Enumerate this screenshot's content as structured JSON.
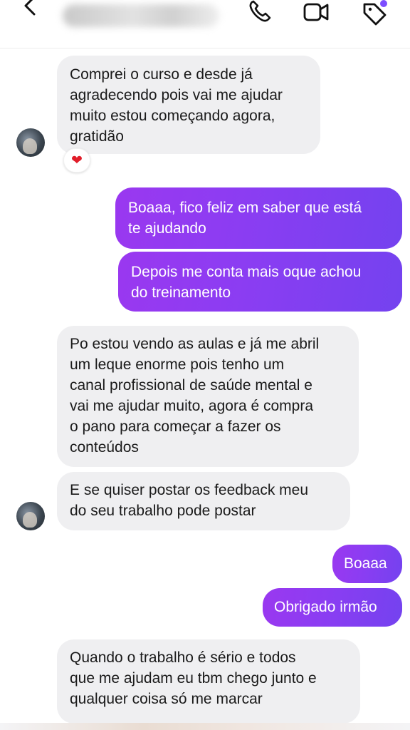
{
  "header": {
    "contact_name": "",
    "back_icon": "chevron-left-icon",
    "call_icon": "phone-icon",
    "video_icon": "video-camera-icon",
    "tag_icon": "tag-icon"
  },
  "colors": {
    "outgoing_bubble_start": "#9a38f0",
    "outgoing_bubble_end": "#7442ef",
    "incoming_bubble": "#efeff1",
    "notification_dot": "#7c4dff"
  },
  "messages": [
    {
      "direction": "in",
      "text": "Comprei o curso e desde já\nagradecendo pois vai me ajudar\nmuito estou começando agora,\ngratidão",
      "reaction": "❤"
    },
    {
      "direction": "out",
      "text": "Boaaa, fico feliz em saber que está\nte ajudando"
    },
    {
      "direction": "out",
      "text": "Depois me conta mais oque achou\ndo treinamento"
    },
    {
      "direction": "in",
      "text": "Po estou vendo as aulas e já me abril\num leque enorme pois tenho um\ncanal profissional de saúde mental e\nvai me ajudar muito, agora é compra\no pano para começar a fazer os\nconteúdos"
    },
    {
      "direction": "in",
      "text": "E se quiser postar os feedback meu\ndo seu trabalho pode postar"
    },
    {
      "direction": "out",
      "text": "Boaaa"
    },
    {
      "direction": "out",
      "text": "Obrigado irmão"
    },
    {
      "direction": "in",
      "text": "Quando o trabalho é sério e todos\nque me ajudam eu tbm chego junto e\nqualquer coisa só me marcar"
    }
  ]
}
